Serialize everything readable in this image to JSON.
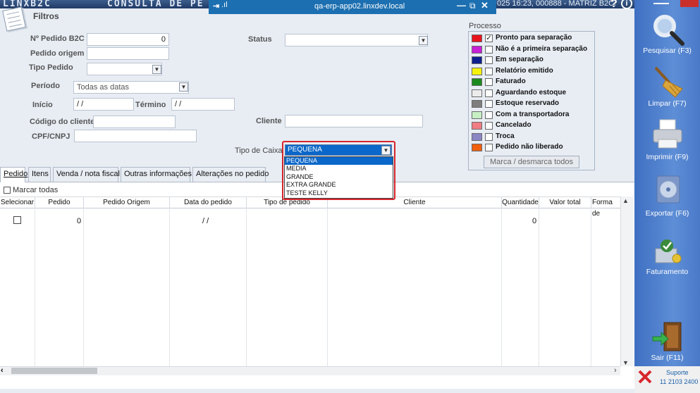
{
  "app": {
    "title": "LINXB2C",
    "screen_title": "CONSULTA DE PE",
    "session_info": "025 16:23, 000888 - MATRIZ B2C.",
    "help": "?",
    "info": "i"
  },
  "rdp": {
    "host": "qa-erp-app02.linxdev.local",
    "pin": "⇥",
    "signal": ".ıl",
    "min": "—",
    "restore": "⧉",
    "close": "✕"
  },
  "filtros": {
    "title": "Filtros",
    "pedido_b2c_label": "Nº Pedido B2C",
    "pedido_b2c_value": "0",
    "pedido_origem_label": "Pedido origem",
    "pedido_origem_value": "",
    "tipo_pedido_label": "Tipo Pedido",
    "tipo_pedido_value": "",
    "periodo_label": "Período",
    "periodo_value": "Todas as datas",
    "inicio_label": "Início",
    "inicio_value": " /  /",
    "termino_label": "Término",
    "termino_value": " /  /",
    "codigo_cliente_label": "Código do cliente",
    "codigo_cliente_value": "",
    "cpf_label": "CPF/CNPJ",
    "cpf_value": "",
    "status_label": "Status",
    "status_value": "",
    "cliente_label": "Cliente",
    "cliente_value": "",
    "tipo_caixa_label": "Tipo de Caixa",
    "tipo_caixa_value": "PEQUENA",
    "tipo_caixa_options": [
      "PEQUENA",
      "MEDIA",
      "GRANDE",
      "EXTRA GRANDE",
      "TESTE KELLY"
    ]
  },
  "processo": {
    "title": "Processo",
    "items": [
      {
        "label": "Pronto para separação",
        "color": "#e8141b",
        "checked": true
      },
      {
        "label": "Não é a primeira separação",
        "color": "#c81fd6",
        "checked": false
      },
      {
        "label": "Em separação",
        "color": "#0d1f8f",
        "checked": false
      },
      {
        "label": "Relatório emitido",
        "color": "#f5f20e",
        "checked": false
      },
      {
        "label": "Faturado",
        "color": "#1b8a1e",
        "checked": false
      },
      {
        "label": "Aguardando estoque",
        "color": "#ececec",
        "checked": false
      },
      {
        "label": "Estoque reservado",
        "color": "#7e7e7e",
        "checked": false
      },
      {
        "label": "Com a transportadora",
        "color": "#c7efc4",
        "checked": false
      },
      {
        "label": "Cancelado",
        "color": "#f07c84",
        "checked": false
      },
      {
        "label": "Troca",
        "color": "#8b86c4",
        "checked": false
      },
      {
        "label": "Pedido não liberado",
        "color": "#f0600e",
        "checked": false
      }
    ],
    "marca_button": "Marca / desmarca todos"
  },
  "tabs": [
    "Pedido",
    "Itens",
    "Venda / nota fiscal",
    "Outras informações",
    "Alterações no pedido"
  ],
  "grid": {
    "marcar_todas": "Marcar todas",
    "columns": [
      "Selecionar",
      "Pedido",
      "Pedido Origem",
      "Data do pedido",
      "Tipo de pedido",
      "Cliente",
      "Quantidade",
      "Valor total",
      "Forma de"
    ],
    "row": {
      "pedido": "0",
      "data": "/  /",
      "quantidade": "0"
    }
  },
  "sidebar": {
    "pesquisar": "Pesquisar (F3)",
    "limpar": "Limpar (F7)",
    "imprimir": "Imprimir (F9)",
    "exportar": "Exportar (F6)",
    "faturamento": "Faturamento",
    "sair": "Sair (F11)",
    "suporte_title": "Suporte",
    "suporte_phone": "11 2103 2400"
  }
}
